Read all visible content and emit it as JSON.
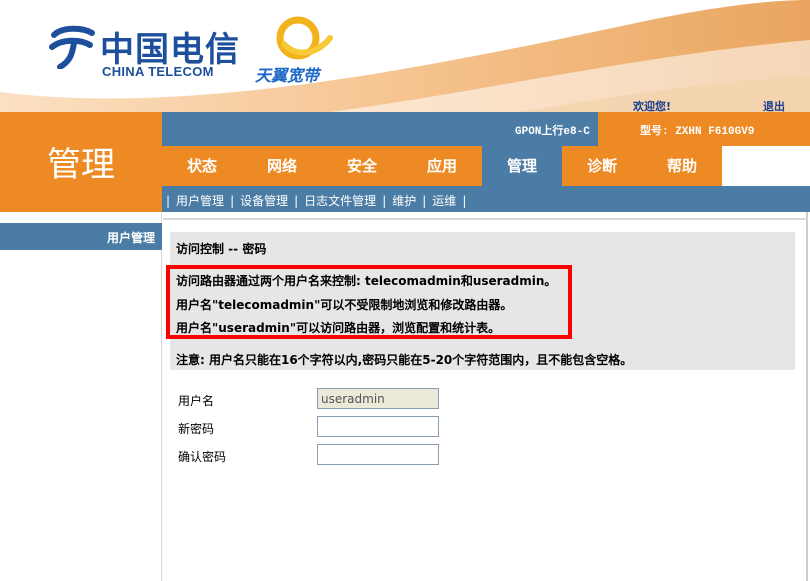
{
  "header": {
    "brand_cn": "中国电信",
    "brand_en": "CHINA TELECOM",
    "product": "天翼宽带",
    "welcome": "欢迎您!",
    "logout": "退出"
  },
  "left_title": "管理",
  "info_bar": {
    "gpon": "GPON上行e8-C",
    "model": "型号: ZXHN F610GV9"
  },
  "nav": {
    "items": [
      "状态",
      "网络",
      "安全",
      "应用",
      "管理",
      "诊断",
      "帮助"
    ],
    "active": "管理"
  },
  "subnav": {
    "items": [
      "用户管理",
      "设备管理",
      "日志文件管理",
      "维护",
      "运维"
    ]
  },
  "sidebar": {
    "active_item": "用户管理"
  },
  "panel": {
    "title": "访问控制 -- 密码",
    "line1": "访问路由器通过两个用户名来控制: telecomadmin和useradmin。",
    "line2": "用户名\"telecomadmin\"可以不受限制地浏览和修改路由器。",
    "line3": "用户名\"useradmin\"可以访问路由器，浏览配置和统计表。",
    "note": "注意: 用户名只能在16个字符以内,密码只能在5-20个字符范围内，且不能包含空格。"
  },
  "form": {
    "username_label": "用户名",
    "username_value": "useradmin",
    "new_password_label": "新密码",
    "new_password_value": "",
    "confirm_password_label": "确认密码",
    "confirm_password_value": ""
  },
  "colors": {
    "orange": "#ee8a23",
    "steel_blue": "#4b7ca5",
    "highlight_red": "#ff0000",
    "brand_blue": "#1e4f9c"
  }
}
